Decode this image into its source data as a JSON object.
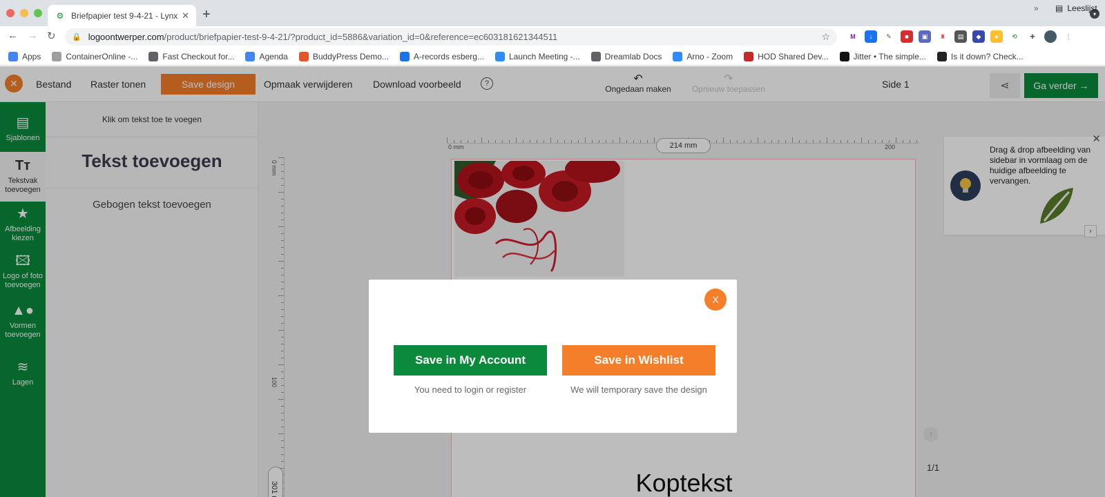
{
  "browser": {
    "tab_title": "Briefpapier test 9-4-21 - Lynx",
    "tab_close": "✕",
    "new_tab": "+",
    "url_host": "logoontwerper.com",
    "url_path": "/product/briefpapier-test-9-4-21/?product_id=5886&variation_id=0&reference=ec603181621344511",
    "bookmarks": [
      {
        "label": "Apps",
        "color": "#4285f4"
      },
      {
        "label": "ContainerOnline -...",
        "color": "#9e9e9e"
      },
      {
        "label": "Fast Checkout for...",
        "color": "#5f6368"
      },
      {
        "label": "Agenda",
        "color": "#4285f4"
      },
      {
        "label": "BuddyPress Demo...",
        "color": "#e8542a"
      },
      {
        "label": "A-records esberg...",
        "color": "#1a73e8"
      },
      {
        "label": "Launch Meeting -...",
        "color": "#2d8cff"
      },
      {
        "label": "Dreamlab Docs",
        "color": "#5f6368"
      },
      {
        "label": "Arno - Zoom",
        "color": "#2d8cff"
      },
      {
        "label": "HOD Shared Dev...",
        "color": "#c62828"
      },
      {
        "label": "Jitter • The simple...",
        "color": "#111111"
      },
      {
        "label": "Is it down? Check...",
        "color": "#222222"
      }
    ],
    "bookmarks_more": "»",
    "reading_list": "Leeslijst"
  },
  "toolbar": {
    "close_label": "✕",
    "file_label": "Bestand",
    "grid_label": "Raster tonen",
    "save_label": "Save design",
    "clear_label": "Opmaak verwijderen",
    "download_label": "Download voorbeeld",
    "help_label": "?",
    "undo_label": "Ongedaan maken",
    "redo_label": "Opnieuw toepassen",
    "side_label": "Side 1",
    "proceed_label": "Ga verder →"
  },
  "sidebar": {
    "items": [
      {
        "label": "Sjablonen",
        "icon": "template-icon"
      },
      {
        "label": "Tekstvak toevoegen",
        "icon": "text-icon"
      },
      {
        "label": "Afbeelding kiezen",
        "icon": "star-icon"
      },
      {
        "label": "Logo of foto toevoegen",
        "icon": "image-icon"
      },
      {
        "label": "Vormen toevoegen",
        "icon": "shapes-icon"
      },
      {
        "label": "Lagen",
        "icon": "layers-icon"
      }
    ]
  },
  "panel": {
    "hint": "Klik om tekst toe te voegen",
    "heading": "Tekst toevoegen",
    "curved": "Gebogen tekst toevoegen"
  },
  "canvas": {
    "ruler_start": "0 mm",
    "ruler_width": "214 mm",
    "ruler_200": "200",
    "vruler_start": "0 mm",
    "vruler_100": "100",
    "vruler_height": "301 mm",
    "koptekst": "Koptekst",
    "pager": "1/1"
  },
  "tip": {
    "text": "Drag & drop afbeelding van sidebar in vormlaag om de huidige afbeelding te vervangen.",
    "close": "✕",
    "next": "›"
  },
  "modal": {
    "close_label": "X",
    "account_button": "Save in My Account",
    "account_note": "You need to login or register",
    "wishlist_button": "Save in Wishlist",
    "wishlist_note": "We will temporary save the design"
  },
  "colors": {
    "brand_green": "#0a8a3a",
    "brand_orange": "#f47e2a"
  }
}
